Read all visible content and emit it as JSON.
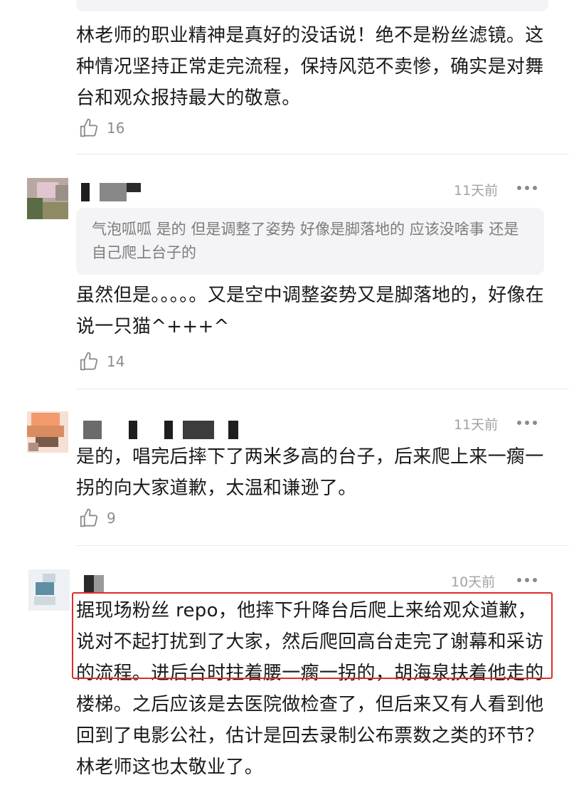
{
  "comments": [
    {
      "text": "林老师的职业精神是真好的没话说！绝不是粉丝滤镜。这种情况坚持正常走完流程，保持风范不卖惨，确实是对舞台和观众报持最大的敬意。",
      "likes": "16"
    },
    {
      "time": "11天前",
      "quote": "气泡呱呱 是的 但是调整了姿势 好像是脚落地的 应该没啥事 还是自己爬上台子的",
      "text": "虽然但是。。。。。又是空中调整姿势又是脚落地的，好像在说一只猫^+++^",
      "likes": "14"
    },
    {
      "time": "11天前",
      "text": "是的，唱完后摔下了两米多高的台子，后来爬上来一瘸一拐的向大家道歉，太温和谦逊了。",
      "likes": "9"
    },
    {
      "time": "10天前",
      "text": "据现场粉丝 repo，他摔下升降台后爬上来给观众道歉，说对不起打扰到了大家，然后爬回高台走完了谢幕和采访的流程。进后台时拄着腰一瘸一拐的，胡海泉扶着他走的楼梯。之后应该是去医院做检查了，但后来又有人看到他回到了电影公社，估计是回去录制公布票数之类的环节？林老师这也太敬业了。"
    }
  ],
  "icons": {
    "like": "thumbs-up-icon",
    "more": "more-dots-icon"
  },
  "colors": {
    "highlight": "#e02b2b",
    "muted": "#a2a2a2"
  }
}
